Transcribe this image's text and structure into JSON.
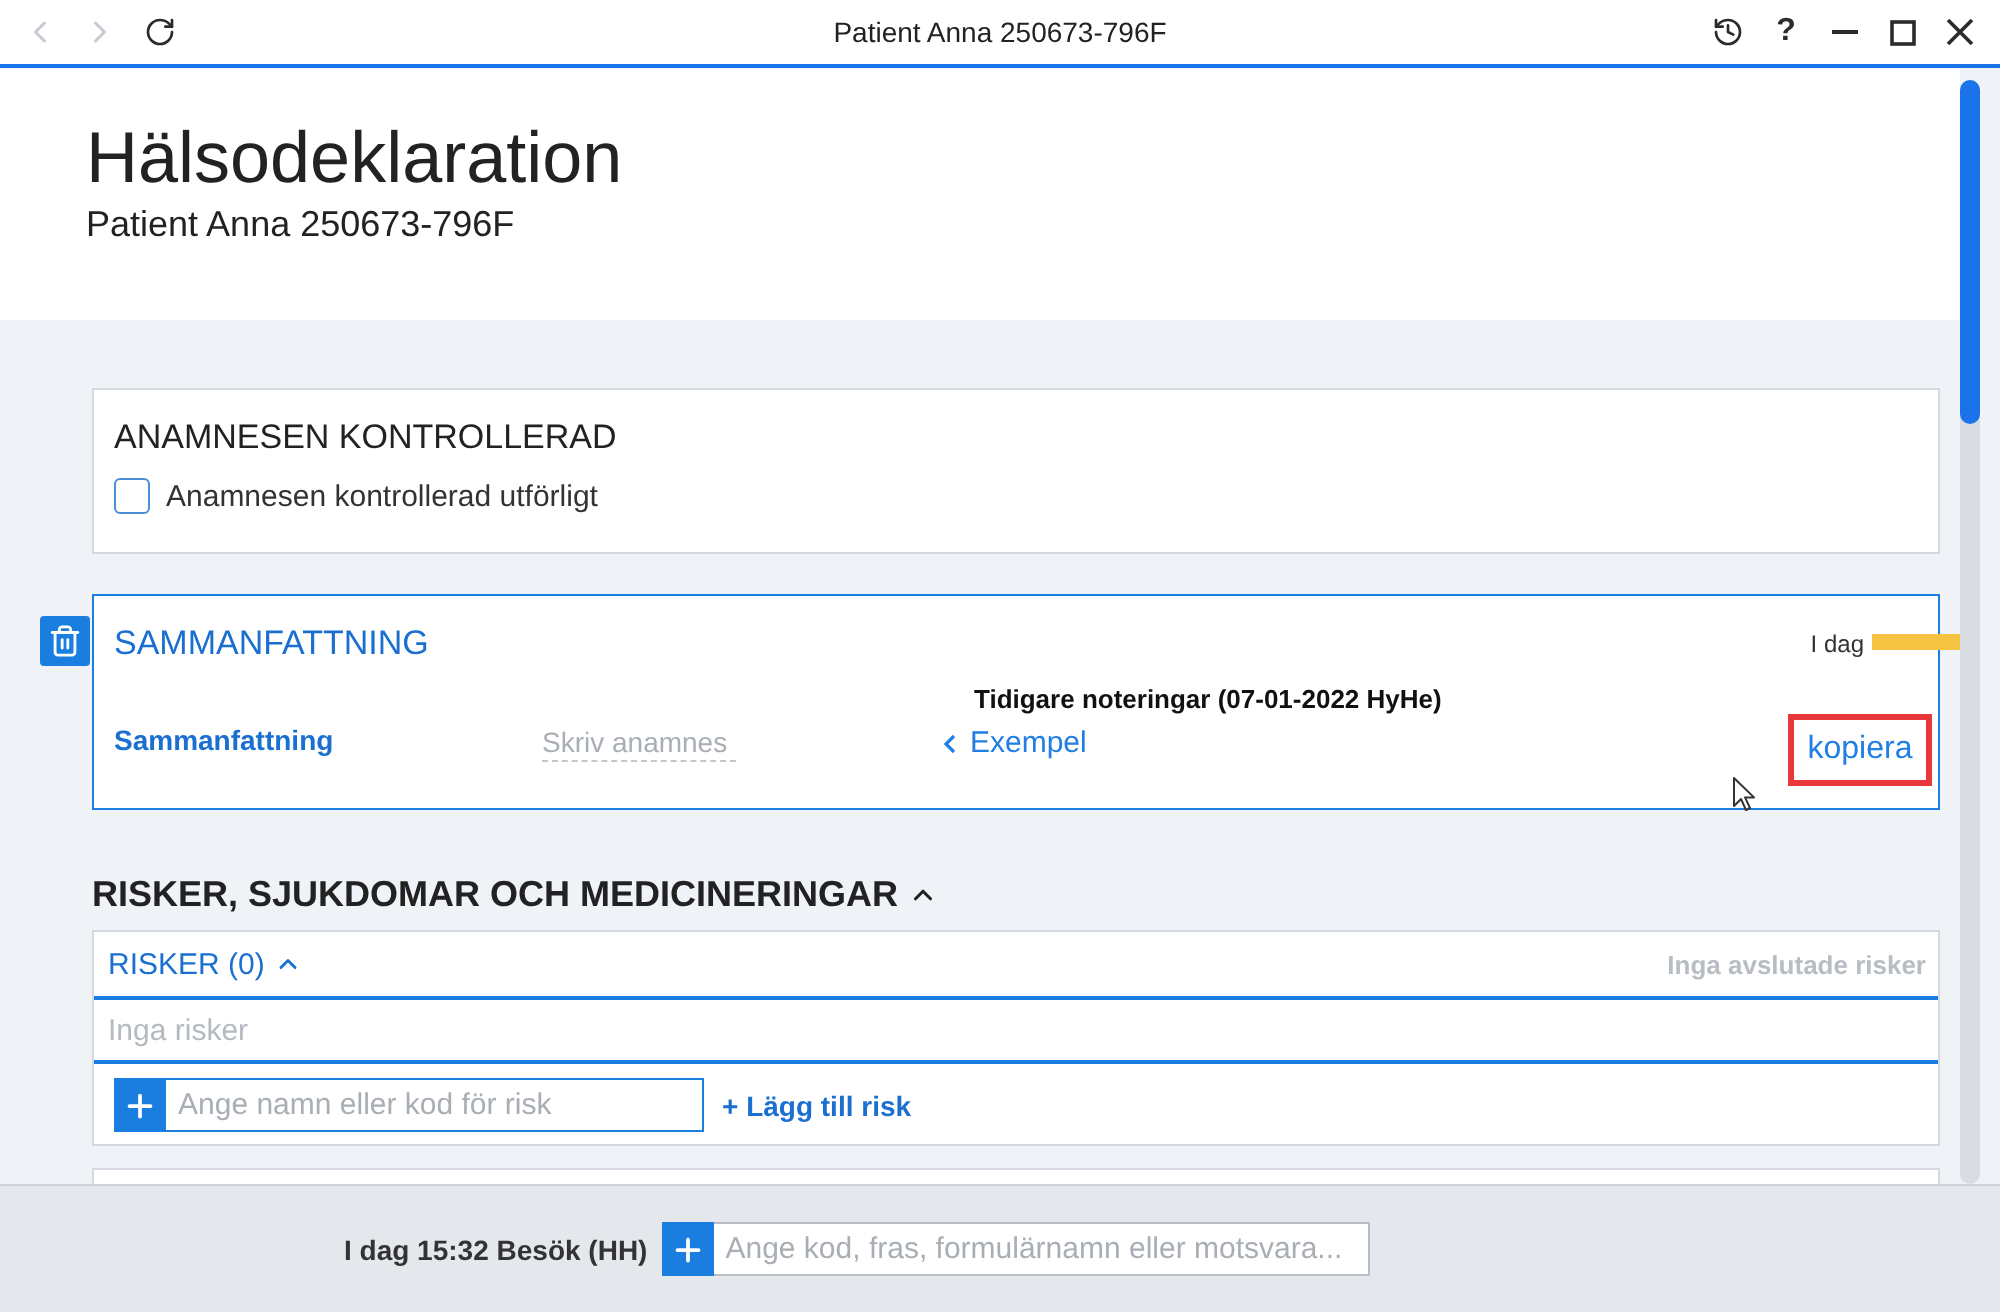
{
  "window": {
    "title": "Patient Anna 250673-796F",
    "nav_buttons": [
      {
        "kind": "back",
        "disabled": true
      },
      {
        "kind": "forward",
        "disabled": true
      },
      {
        "kind": "reload",
        "disabled": false
      }
    ],
    "help": "?"
  },
  "header": {
    "title": "Hälsodeklaration",
    "subtitle": "Patient Anna 250673-796F"
  },
  "check_card": {
    "title": "ANAMNESEN KONTROLLERAD",
    "checkbox": {
      "label": "Anamnesen kontrollerad utförligt",
      "checked": false
    }
  },
  "summary_card": {
    "title": "SAMMANFATTNING",
    "date": "I dag",
    "field_label": "Sammanfattning",
    "placeholder": "Skriv anamnes",
    "previous_heading": "Tidigare noteringar (07-01-2022 HyHe)",
    "previous_link": "Exempel",
    "copy_link": {
      "label": "kopiera",
      "highlighted": true
    }
  },
  "section": {
    "title": "RISKER, SJUKDOMAR OCH MEDICINERINGAR",
    "expanded": true
  },
  "risks": {
    "title": "RISKER (0)",
    "expanded": true,
    "closed_note": "Inga avslutade risker",
    "empty_text": "Inga risker",
    "input_placeholder": "Ange namn eller kod för risk",
    "add_link": "+ Lägg till risk"
  },
  "footer": {
    "visit": "I dag 15:32 Besök (HH)",
    "input_placeholder": "Ange kod, fras, formulärnamn eller motsvara..."
  }
}
